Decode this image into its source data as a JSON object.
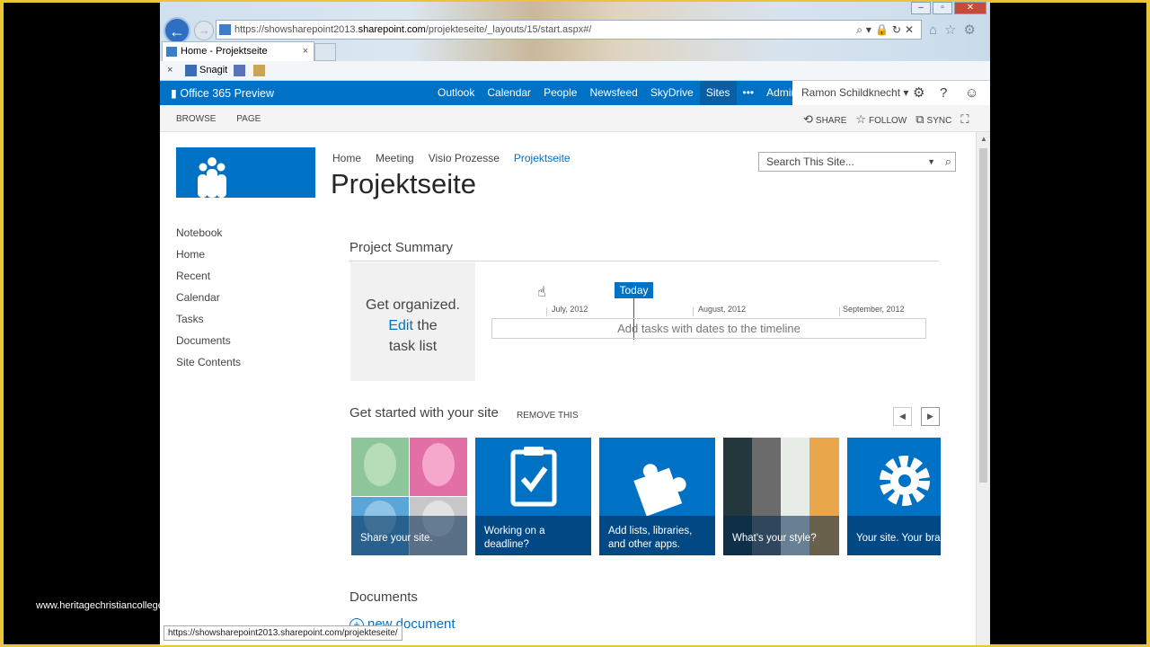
{
  "watermark": "www.heritagechristiancollege.com",
  "browser": {
    "url_prefix": "https://showsharepoint2013.",
    "url_host": "sharepoint.com",
    "url_path": "/projekteseite/_layouts/15/start.aspx#/",
    "tab_title": "Home - Projektseite",
    "tab_close": "×",
    "fav_close": "×",
    "fav_snagit": "Snagit",
    "status_url": "https://showsharepoint2013.sharepoint.com/projekteseite/"
  },
  "suitebar": {
    "brand": "Office 365 Preview",
    "nav": [
      "Outlook",
      "Calendar",
      "People",
      "Newsfeed",
      "SkyDrive",
      "Sites",
      "•••",
      "Admin ▾"
    ],
    "user": "Ramon Schildknecht ▾"
  },
  "ribbon": {
    "tabs": [
      "BROWSE",
      "PAGE"
    ],
    "share": "SHARE",
    "follow": "FOLLOW",
    "sync": "SYNC"
  },
  "site": {
    "topnav": [
      "Home",
      "Meeting",
      "Visio Prozesse",
      "Projektseite"
    ],
    "title": "Projektseite",
    "search_placeholder": "Search This Site...",
    "leftnav": [
      "Notebook",
      "Home",
      "Recent",
      "Calendar",
      "Tasks",
      "Documents",
      "Site Contents"
    ]
  },
  "summary": {
    "heading": "Project Summary",
    "get_organized_1": "Get organized.",
    "edit": "Edit",
    "the": " the",
    "task_list": "task list",
    "today": "Today",
    "months": [
      "July, 2012",
      "August, 2012",
      "September, 2012"
    ],
    "timeline_placeholder": "Add tasks with dates to the timeline"
  },
  "getstarted": {
    "heading": "Get started with your site",
    "remove": "REMOVE THIS",
    "tiles": [
      "Share your site.",
      "Working on a deadline?",
      "Add lists, libraries, and other apps.",
      "What's your style?",
      "Your site. Your brand."
    ]
  },
  "documents": {
    "heading": "Documents",
    "new_document": "new document"
  },
  "colors": {
    "brand_blue": "#0072c6"
  }
}
